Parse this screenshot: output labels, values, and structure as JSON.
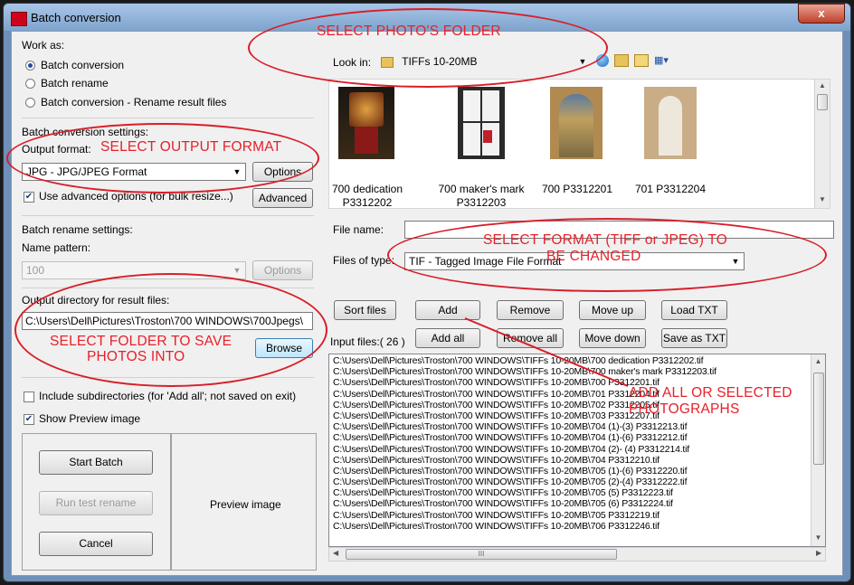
{
  "window": {
    "title": "Batch conversion",
    "close_label": "x"
  },
  "work_as": {
    "heading": "Work as:",
    "options": [
      "Batch conversion",
      "Batch rename",
      "Batch conversion - Rename result files"
    ],
    "selected": "Batch conversion"
  },
  "conversion": {
    "heading": "Batch conversion settings:",
    "output_format_label": "Output format:",
    "output_format_value": "JPG - JPG/JPEG Format",
    "options_button": "Options",
    "advanced_check_label": "Use advanced options (for bulk resize...)",
    "advanced_checked": true,
    "advanced_button": "Advanced"
  },
  "rename": {
    "heading": "Batch rename settings:",
    "name_pattern_label": "Name pattern:",
    "name_pattern_value": "100",
    "options_button": "Options"
  },
  "output_dir": {
    "label": "Output directory for result files:",
    "value": "C:\\Users\\Dell\\Pictures\\Troston\\700 WINDOWS\\700Jpegs\\",
    "browse_button": "Browse"
  },
  "flags": {
    "include_subdirs_label": "Include subdirectories (for 'Add all'; not saved on exit)",
    "include_subdirs_checked": false,
    "show_preview_label": "Show Preview image",
    "show_preview_checked": true
  },
  "actions": {
    "start": "Start Batch",
    "test_rename": "Run test rename",
    "cancel": "Cancel"
  },
  "preview": {
    "label": "Preview image"
  },
  "browser": {
    "look_in_label": "Look in:",
    "look_in_value": "TIFFs 10-20MB",
    "thumbnails": [
      {
        "caption_1": "700 dedication",
        "caption_2": "P3312202"
      },
      {
        "caption_1": "700 maker's mark",
        "caption_2": "P3312203"
      },
      {
        "caption_1": "700 P3312201",
        "caption_2": ""
      },
      {
        "caption_1": "701 P3312204",
        "caption_2": ""
      }
    ],
    "file_name_label": "File name:",
    "file_name_value": "",
    "files_of_type_label": "Files of type:",
    "files_of_type_value": "TIF - Tagged Image File Format"
  },
  "list_buttons": {
    "sort_files": "Sort files",
    "add": "Add",
    "remove": "Remove",
    "move_up": "Move up",
    "load_txt": "Load TXT",
    "add_all": "Add all",
    "remove_all": "Remove all",
    "move_down": "Move down",
    "save_as_txt": "Save as TXT"
  },
  "input_files": {
    "label": "Input files:( 26 )",
    "items": [
      "C:\\Users\\Dell\\Pictures\\Troston\\700 WINDOWS\\TIFFs 10-20MB\\700 dedication P3312202.tif",
      "C:\\Users\\Dell\\Pictures\\Troston\\700 WINDOWS\\TIFFs 10-20MB\\700 maker's mark P3312203.tif",
      "C:\\Users\\Dell\\Pictures\\Troston\\700 WINDOWS\\TIFFs 10-20MB\\700 P3312201.tif",
      "C:\\Users\\Dell\\Pictures\\Troston\\700 WINDOWS\\TIFFs 10-20MB\\701 P3312204.tif",
      "C:\\Users\\Dell\\Pictures\\Troston\\700 WINDOWS\\TIFFs 10-20MB\\702 P3312205.tif",
      "C:\\Users\\Dell\\Pictures\\Troston\\700 WINDOWS\\TIFFs 10-20MB\\703 P3312207.tif",
      "C:\\Users\\Dell\\Pictures\\Troston\\700 WINDOWS\\TIFFs 10-20MB\\704 (1)-(3) P3312213.tif",
      "C:\\Users\\Dell\\Pictures\\Troston\\700 WINDOWS\\TIFFs 10-20MB\\704 (1)-(6) P3312212.tif",
      "C:\\Users\\Dell\\Pictures\\Troston\\700 WINDOWS\\TIFFs 10-20MB\\704 (2)- (4) P3312214.tif",
      "C:\\Users\\Dell\\Pictures\\Troston\\700 WINDOWS\\TIFFs 10-20MB\\704 P3312210.tif",
      "C:\\Users\\Dell\\Pictures\\Troston\\700 WINDOWS\\TIFFs 10-20MB\\705 (1)-(6) P3312220.tif",
      "C:\\Users\\Dell\\Pictures\\Troston\\700 WINDOWS\\TIFFs 10-20MB\\705 (2)-(4) P3312222.tif",
      "C:\\Users\\Dell\\Pictures\\Troston\\700 WINDOWS\\TIFFs 10-20MB\\705 (5) P3312223.tif",
      "C:\\Users\\Dell\\Pictures\\Troston\\700 WINDOWS\\TIFFs 10-20MB\\705 (6) P3312224.tif",
      "C:\\Users\\Dell\\Pictures\\Troston\\700 WINDOWS\\TIFFs 10-20MB\\705 P3312219.tif",
      "C:\\Users\\Dell\\Pictures\\Troston\\700 WINDOWS\\TIFFs 10-20MB\\706 P3312246.tif"
    ],
    "hscroll_label": "III"
  },
  "annotations": {
    "photo_folder": "SELECT PHOTO'S FOLDER",
    "output_format": "SELECT OUTPUT FORMAT",
    "format_line_1": "SELECT FORMAT (TIFF or JPEG) TO",
    "format_line_2": "BE CHANGED",
    "save_folder_line_1": "SELECT FOLDER TO SAVE",
    "save_folder_line_2": "PHOTOS INTO",
    "add_line_1": "ADD ALL OR SELECTED",
    "add_line_2": "PHOTOGRAPHS",
    "color": "#e8202a"
  }
}
